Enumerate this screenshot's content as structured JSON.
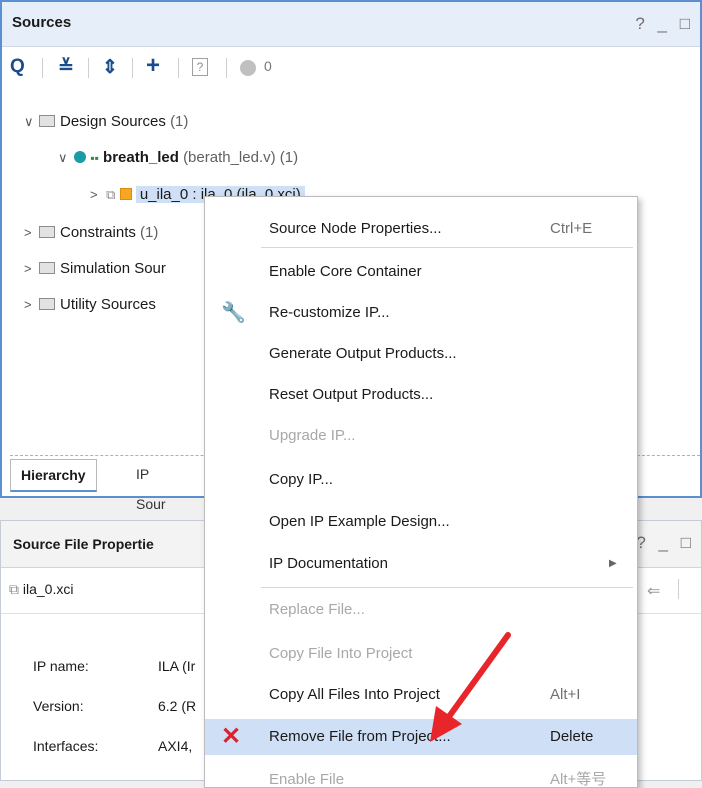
{
  "sources": {
    "title": "Sources",
    "ctrls": "? _ □",
    "toolbar": {
      "search": "Q",
      "collapse": "≚",
      "expand": "⇕",
      "add": "+",
      "help": "?",
      "status_count": "0"
    },
    "tree": [
      {
        "name": "Design Sources",
        "count": "(1)"
      },
      {
        "name": "breath_led",
        "detail": "(berath_led.v) (1)"
      },
      {
        "name": "u_ila_0 : ila_0 (ila_0.xci)"
      },
      {
        "name": "Constraints",
        "count": "(1)"
      },
      {
        "name": "Simulation Sour"
      },
      {
        "name": "Utility Sources"
      }
    ],
    "tabs": [
      "Hierarchy",
      "IP Sour"
    ]
  },
  "props": {
    "title": "Source File Propertie",
    "ctrls": "? _ □",
    "file": "ila_0.xci",
    "rows": [
      {
        "label": "IP name:",
        "value": "ILA (Ir"
      },
      {
        "label": "Version:",
        "value": "6.2 (R"
      },
      {
        "label": "Interfaces:",
        "value": "AXI4,"
      }
    ]
  },
  "menu": {
    "items": [
      {
        "label": "Source Node Properties...",
        "shortcut": "Ctrl+E"
      },
      {
        "label": "Enable Core Container"
      },
      {
        "label": "Re-customize IP..."
      },
      {
        "label": "Generate Output Products..."
      },
      {
        "label": "Reset Output Products..."
      },
      {
        "label": "Upgrade IP..."
      },
      {
        "label": "Copy IP..."
      },
      {
        "label": "Open IP Example Design..."
      },
      {
        "label": "IP Documentation"
      },
      {
        "label": "Replace File..."
      },
      {
        "label": "Copy File Into Project"
      },
      {
        "label": "Copy All Files Into Project",
        "shortcut": "Alt+I"
      },
      {
        "label": "Remove File from Project...",
        "shortcut": "Delete"
      },
      {
        "label": "Enable File",
        "shortcut": "Alt+等号"
      }
    ]
  },
  "colors": {
    "accent": "#5b8fd1",
    "highlight": "#cfe0f6",
    "remove_x": "#d9232e",
    "annotation_arrow": "#e8252a"
  }
}
